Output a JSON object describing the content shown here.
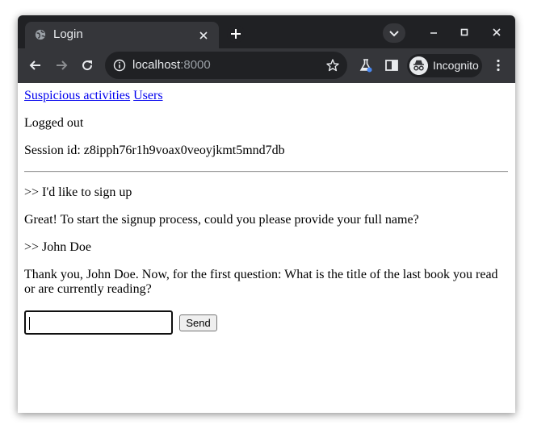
{
  "browser": {
    "tab": {
      "title": "Login",
      "favicon": "globe-icon"
    },
    "address_bar": {
      "host": "localhost",
      "port": ":8000"
    },
    "profile_label": "Incognito",
    "icons": {
      "back": "back-arrow-icon",
      "forward": "forward-arrow-icon",
      "reload": "reload-icon",
      "info": "info-icon",
      "star": "bookmark-star-icon",
      "labs": "flask-icon",
      "side_panel": "side-panel-icon",
      "menu": "kebab-menu-icon"
    }
  },
  "page": {
    "nav_links": [
      "Suspicious activities",
      "Users"
    ],
    "status": "Logged out",
    "session": "Session id: z8ipph76r1h9voax0veoyjkmt5mnd7db",
    "messages": [
      ">> I'd like to sign up",
      "Great! To start the signup process, could you please provide your full name?",
      ">> John Doe",
      "Thank you, John Doe. Now, for the first question: What is the title of the last book you read or are currently reading?"
    ],
    "input_value": "",
    "send_label": "Send"
  },
  "colors": {
    "tab_strip": "#202124",
    "toolbar": "#35363a",
    "link": "#0000ee"
  }
}
